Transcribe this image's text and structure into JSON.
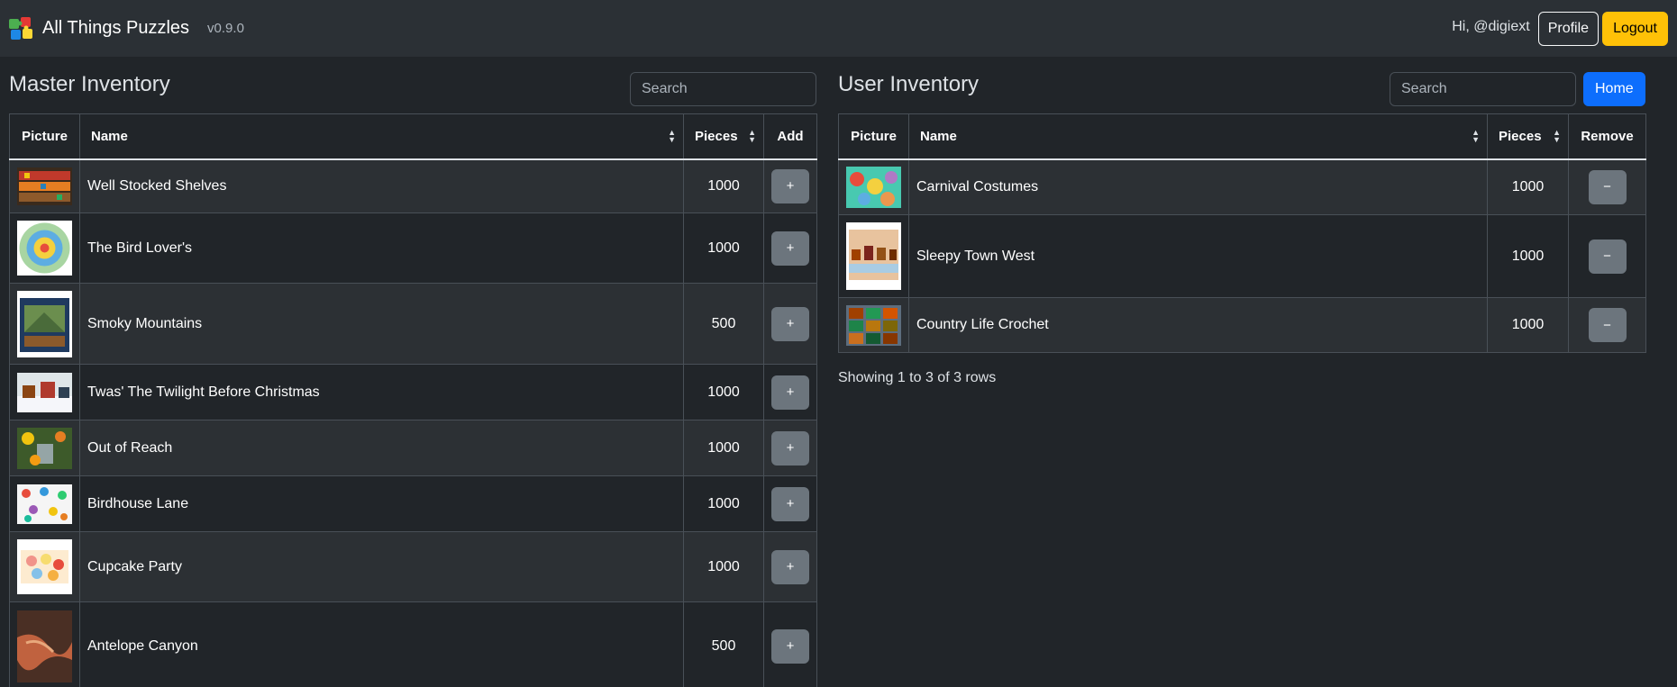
{
  "navbar": {
    "brand": "All Things Puzzles",
    "version": "v0.9.0",
    "greeting": "Hi, @digiext",
    "profile_label": "Profile",
    "logout_label": "Logout"
  },
  "master": {
    "title": "Master Inventory",
    "search_placeholder": "Search",
    "columns": {
      "picture": "Picture",
      "name": "Name",
      "pieces": "Pieces",
      "action": "Add"
    },
    "rows": [
      {
        "name": "Well Stocked Shelves",
        "pieces": "1000",
        "action": "+"
      },
      {
        "name": "The Bird Lover's",
        "pieces": "1000",
        "action": "+"
      },
      {
        "name": "Smoky Mountains",
        "pieces": "500",
        "action": "+"
      },
      {
        "name": "Twas' The Twilight Before Christmas",
        "pieces": "1000",
        "action": "+"
      },
      {
        "name": "Out of Reach",
        "pieces": "1000",
        "action": "+"
      },
      {
        "name": "Birdhouse Lane",
        "pieces": "1000",
        "action": "+"
      },
      {
        "name": "Cupcake Party",
        "pieces": "1000",
        "action": "+"
      },
      {
        "name": "Antelope Canyon",
        "pieces": "500",
        "action": "+"
      }
    ]
  },
  "user": {
    "title": "User Inventory",
    "search_placeholder": "Search",
    "home_label": "Home",
    "columns": {
      "picture": "Picture",
      "name": "Name",
      "pieces": "Pieces",
      "action": "Remove"
    },
    "rows": [
      {
        "name": "Carnival Costumes",
        "pieces": "1000",
        "action": "−"
      },
      {
        "name": "Sleepy Town West",
        "pieces": "1000",
        "action": "−"
      },
      {
        "name": "Country Life Crochet",
        "pieces": "1000",
        "action": "−"
      }
    ],
    "footer": "Showing 1 to 3 of 3 rows"
  }
}
